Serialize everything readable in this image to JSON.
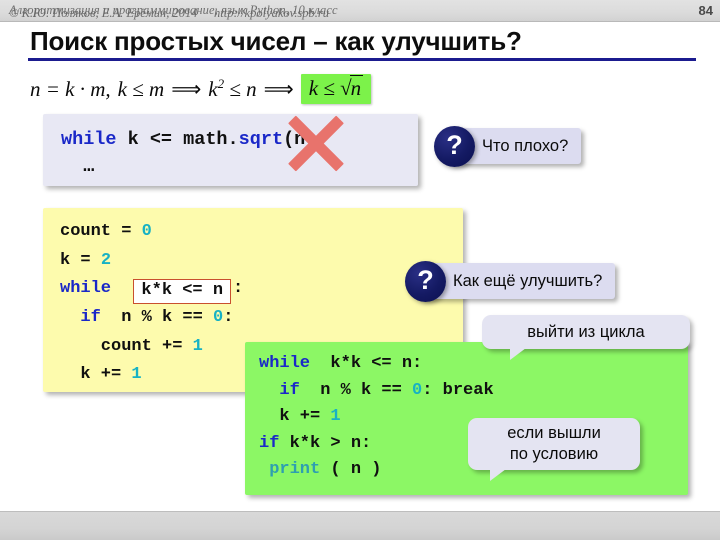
{
  "header": {
    "course_title": "Алгоритмизация и программирование, язык Python, 10 класс",
    "slide_number": "84"
  },
  "title": "Поиск простых чисел – как улучшить?",
  "formula": {
    "part1": "n = k · m,",
    "part2": "k ≤ m",
    "arrow1": "⟹",
    "part3": "k",
    "part3_sup": "2",
    "part3_rest": "≤ n",
    "arrow2": "⟹",
    "highlight_lhs": "k ≤",
    "highlight_radical": "√",
    "highlight_radicand": "n",
    "highlight_color": "#7cf24a"
  },
  "code_sqrt": {
    "kw_while": "while",
    "line1_rest": " k <= math.",
    "fn_sqrt": "sqrt",
    "line1_tail": "(n):",
    "line2": "  …",
    "crossed_out": true,
    "cross_color": "#e8736c",
    "background": "#e8e8f4"
  },
  "code_yellow": {
    "background": "#fdfbad",
    "line1_a": "count = ",
    "line1_num": "0",
    "line2_a": "k = ",
    "line2_num": "2",
    "line3_kw": "while",
    "line3_boxed": "k*k <= n",
    "line3_colon": ":",
    "line4_kw": "  if",
    "line4_mid": "  n % k == ",
    "line4_num": "0",
    "line4_tail": ":",
    "line5_a": "    count += ",
    "line5_num": "1",
    "line6_a": "  k += ",
    "line6_num": "1",
    "box_border_color": "#c8502e"
  },
  "code_green": {
    "background": "#8cf765",
    "line1_kw": "while",
    "line1_rest": "  k*k <= n:",
    "line2_kw": "  if",
    "line2_mid": "  n % k == ",
    "line2_num": "0",
    "line2_tail": ": break",
    "line3_a": "  k += ",
    "line3_num": "1",
    "line4_kw": "if",
    "line4_rest": " k*k > n:",
    "line5_fn": " print",
    "line5_rest": " ( n )"
  },
  "callouts": {
    "what_is_bad": {
      "icon": "question-mark",
      "label": "Что плохо?"
    },
    "how_to_improve": {
      "icon": "question-mark",
      "label": "Как ещё улучшить?"
    },
    "exit_loop": {
      "label": "выйти из цикла"
    },
    "by_condition": {
      "line1": "если вышли",
      "line2": "по условию"
    }
  },
  "footer": {
    "copyright": "© К.Ю. Поляков, Е.А. Ерёмин, 2014",
    "url": "http://kpolyakov.spb.ru"
  }
}
